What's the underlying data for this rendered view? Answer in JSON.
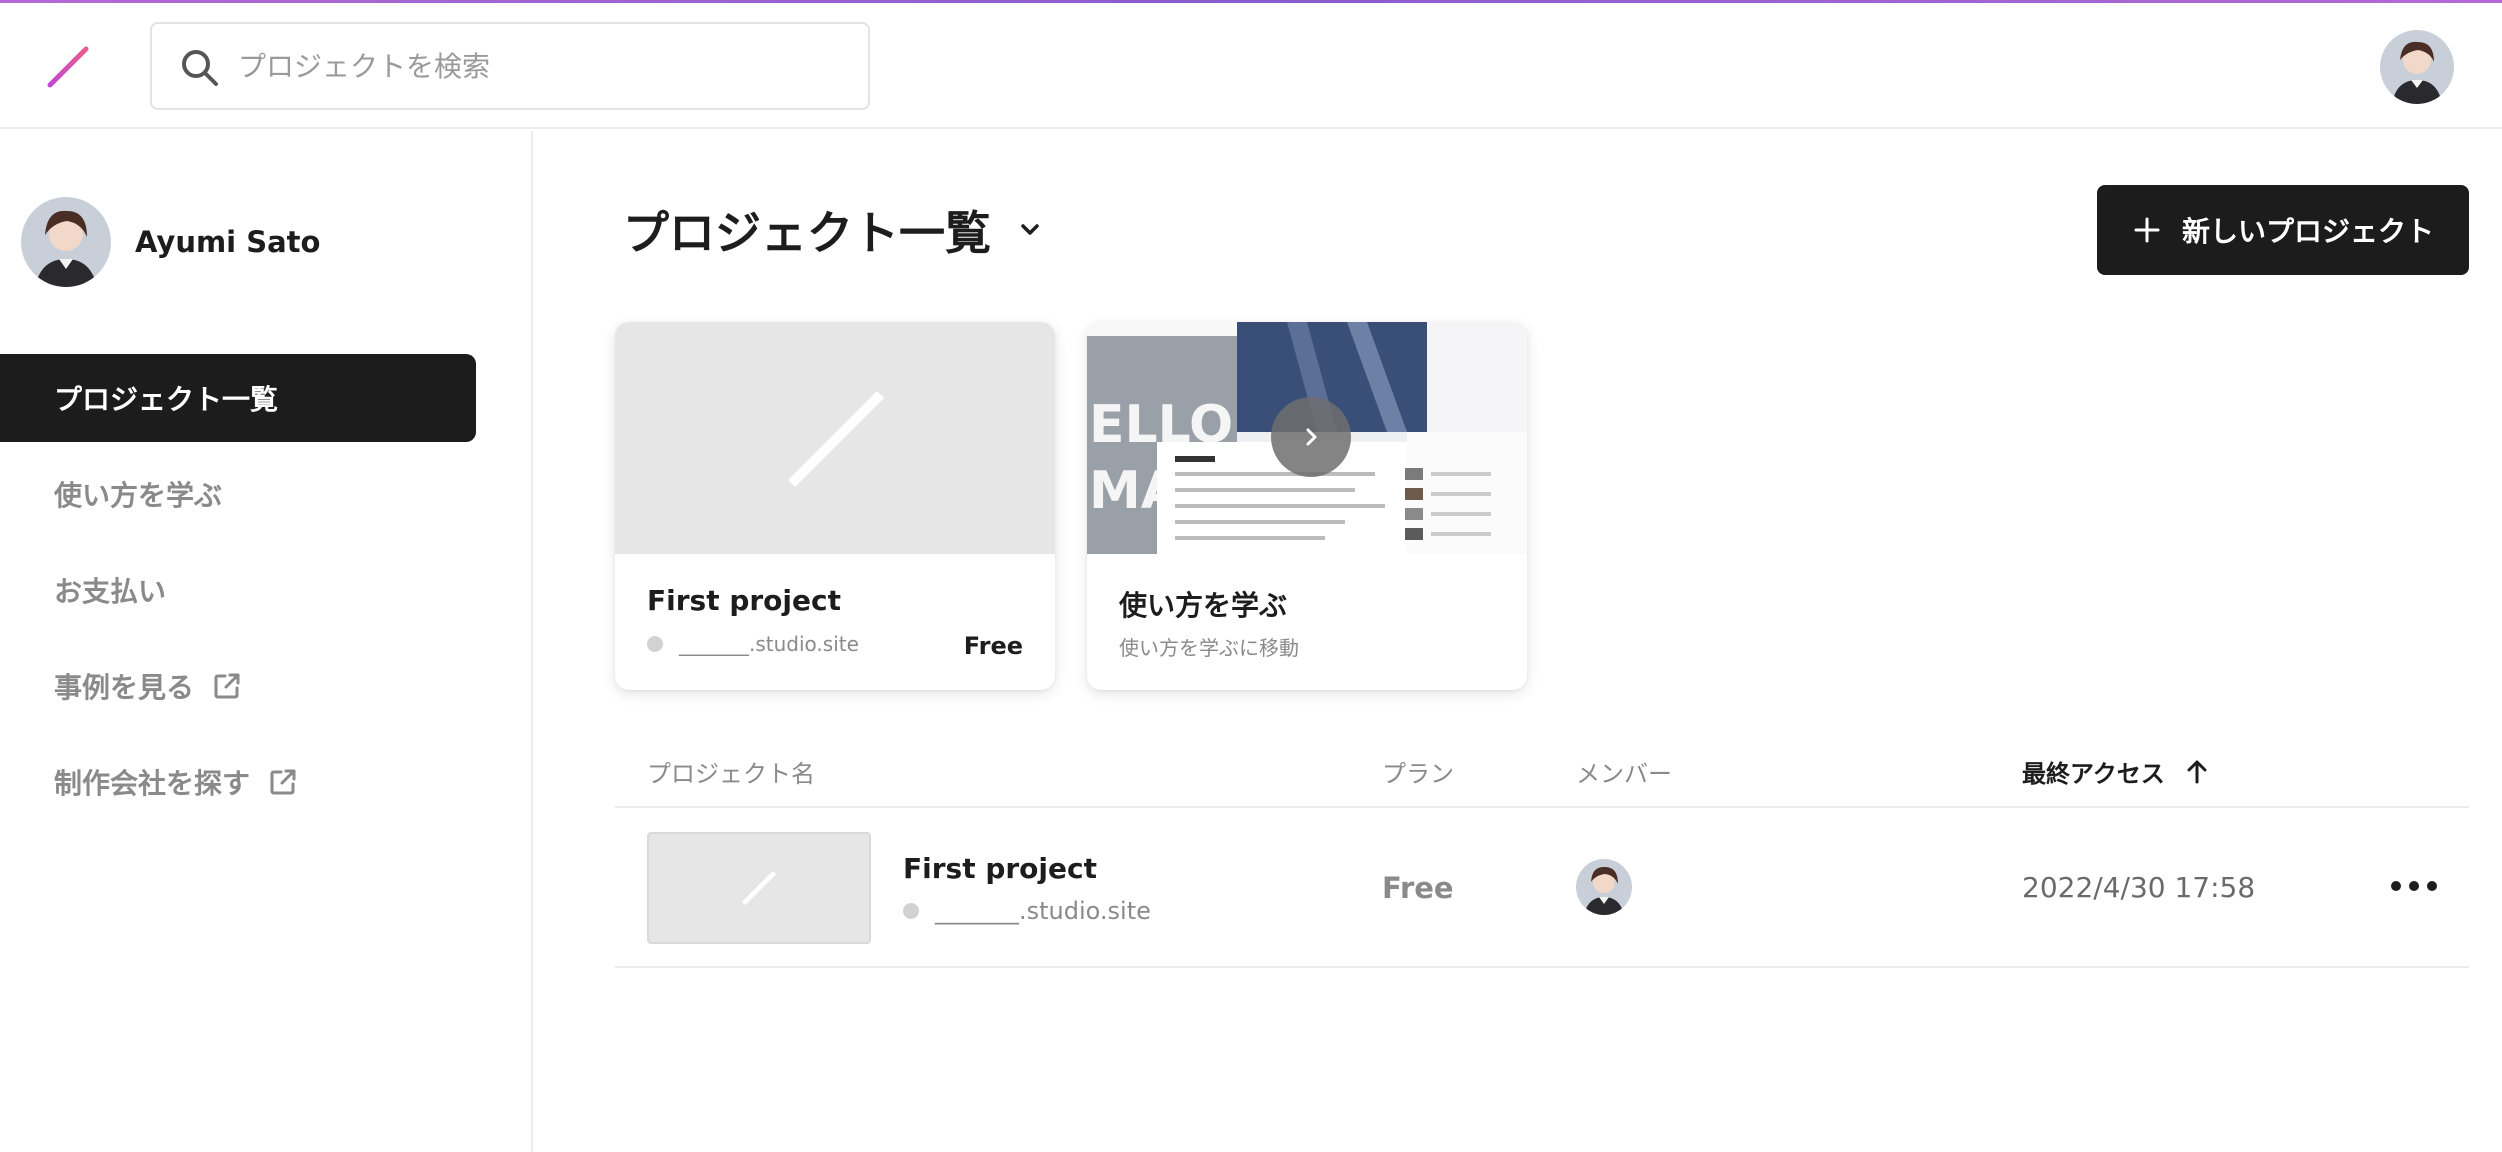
{
  "header": {
    "search_placeholder": "プロジェクトを検索"
  },
  "user": {
    "name": "Ayumi Sato"
  },
  "sidebar": {
    "items": [
      {
        "label": "プロジェクト一覧",
        "active": true,
        "external": false
      },
      {
        "label": "使い方を学ぶ",
        "active": false,
        "external": false
      },
      {
        "label": "お支払い",
        "active": false,
        "external": false
      },
      {
        "label": "事例を見る",
        "active": false,
        "external": true
      },
      {
        "label": "制作会社を探す",
        "active": false,
        "external": true
      }
    ]
  },
  "main": {
    "title": "プロジェクト一覧",
    "new_button_label": "新しいプロジェクト",
    "cards": [
      {
        "title": "First project",
        "subtitle": "_______.studio.site",
        "plan": "Free"
      },
      {
        "title": "使い方を学ぶ",
        "subtitle": "使い方を学ぶに移動"
      }
    ],
    "table": {
      "columns": [
        "プロジェクト名",
        "プラン",
        "メンバー",
        "最終アクセス"
      ],
      "sorted_column": "最終アクセス",
      "sort_direction": "ascending",
      "rows": [
        {
          "name": "First project",
          "domain": "_______.studio.site",
          "plan": "Free",
          "last_access": "2022/4/30 17:58"
        }
      ]
    }
  },
  "colors": {
    "accent": "#e0559e",
    "dark": "#1c1c1c",
    "muted": "#8a8a8a",
    "thumb_bg": "#e6e6e6"
  },
  "icons": [
    "studio-logo-icon",
    "search-icon",
    "chevron-down-icon",
    "plus-icon",
    "external-link-icon",
    "arrow-up-icon",
    "more-icon",
    "play-icon"
  ]
}
